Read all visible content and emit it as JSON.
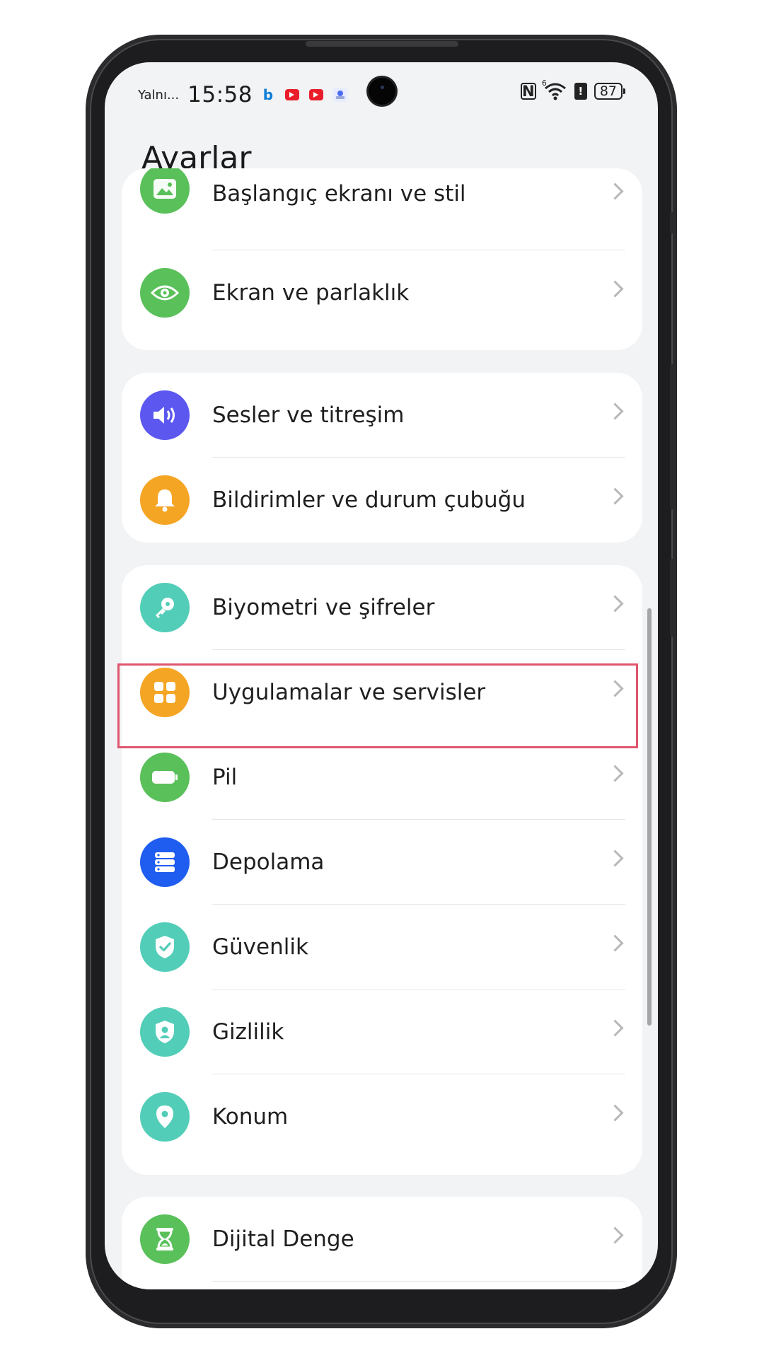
{
  "status_bar": {
    "carrier": "Yalnı...",
    "time": "15:58",
    "battery": "87",
    "network_badge": "6"
  },
  "page": {
    "title": "Ayarlar"
  },
  "colors": {
    "green": "#5ac05a",
    "purple": "#5b57ef",
    "orange": "#f5a524",
    "teal": "#52cdb8",
    "blue": "#1f5df0",
    "highlight": "#e0566d"
  },
  "groups": [
    {
      "items": [
        {
          "label": "Başlangıç ekranı ve stil",
          "icon": "image-icon",
          "color": "#5ac05a"
        },
        {
          "label": "Ekran ve parlaklık",
          "icon": "eye-icon",
          "color": "#5ac05a"
        }
      ]
    },
    {
      "items": [
        {
          "label": "Sesler ve titreşim",
          "icon": "speaker-icon",
          "color": "#5b57ef"
        },
        {
          "label": "Bildirimler ve durum çubuğu",
          "icon": "bell-icon",
          "color": "#f5a524"
        }
      ]
    },
    {
      "items": [
        {
          "label": "Biyometri ve şifreler",
          "icon": "key-icon",
          "color": "#52cdb8"
        },
        {
          "label": "Uygulamalar ve servisler",
          "icon": "apps-grid-icon",
          "color": "#f5a524",
          "highlighted": true
        },
        {
          "label": "Pil",
          "icon": "battery-icon",
          "color": "#5ac05a"
        },
        {
          "label": "Depolama",
          "icon": "storage-icon",
          "color": "#1f5df0"
        },
        {
          "label": "Güvenlik",
          "icon": "shield-check-icon",
          "color": "#52cdb8"
        },
        {
          "label": "Gizlilik",
          "icon": "privacy-shield-icon",
          "color": "#52cdb8"
        },
        {
          "label": "Konum",
          "icon": "location-pin-icon",
          "color": "#52cdb8"
        }
      ]
    },
    {
      "items": [
        {
          "label": "Dijital Denge",
          "icon": "hourglass-icon",
          "color": "#5ac05a"
        }
      ]
    }
  ]
}
